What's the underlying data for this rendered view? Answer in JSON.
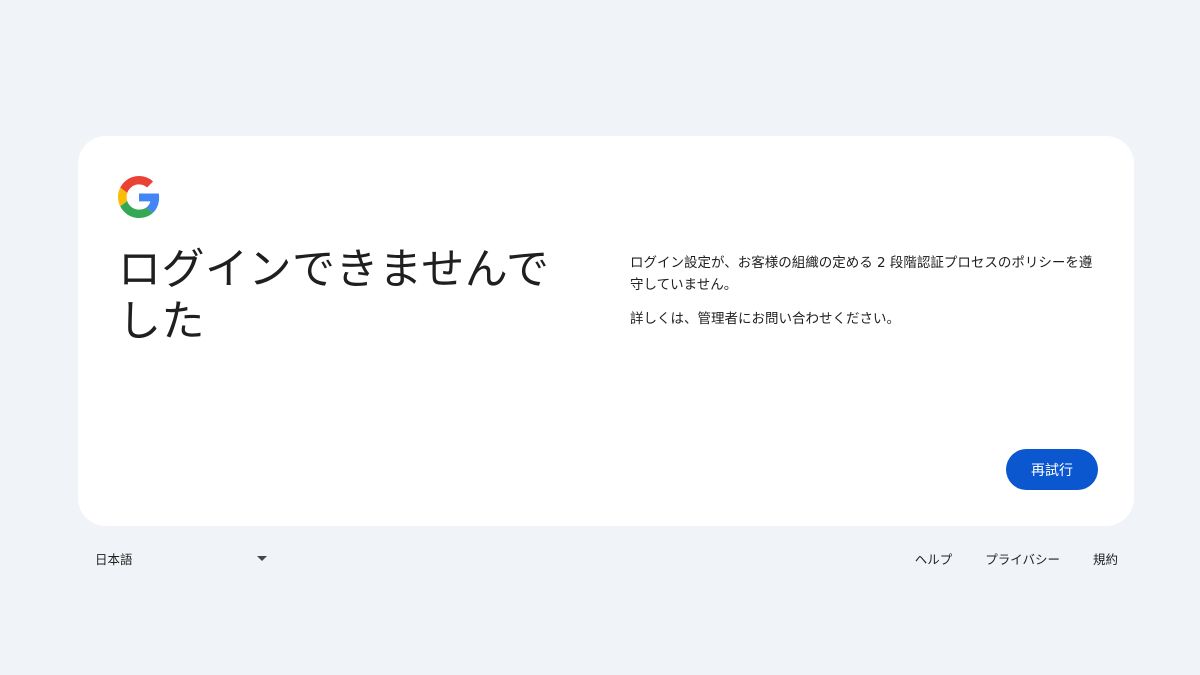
{
  "card": {
    "logo_icon": "google-g-logo",
    "title": "ログインできませんでした",
    "message_lines": [
      "ログイン設定が、お客様の組織の定める 2 段階認証プロセスのポリシーを遵守していません。",
      "詳しくは、管理者にお問い合わせください。"
    ],
    "retry_label": "再試行"
  },
  "footer": {
    "language": "日本語",
    "caret_icon": "caret-down-icon",
    "links": [
      "ヘルプ",
      "プライバシー",
      "規約"
    ]
  },
  "colors": {
    "page_background": "#f0f4f9",
    "card_background": "#ffffff",
    "primary_button": "#0b57d0",
    "text": "#1f1f1f"
  }
}
